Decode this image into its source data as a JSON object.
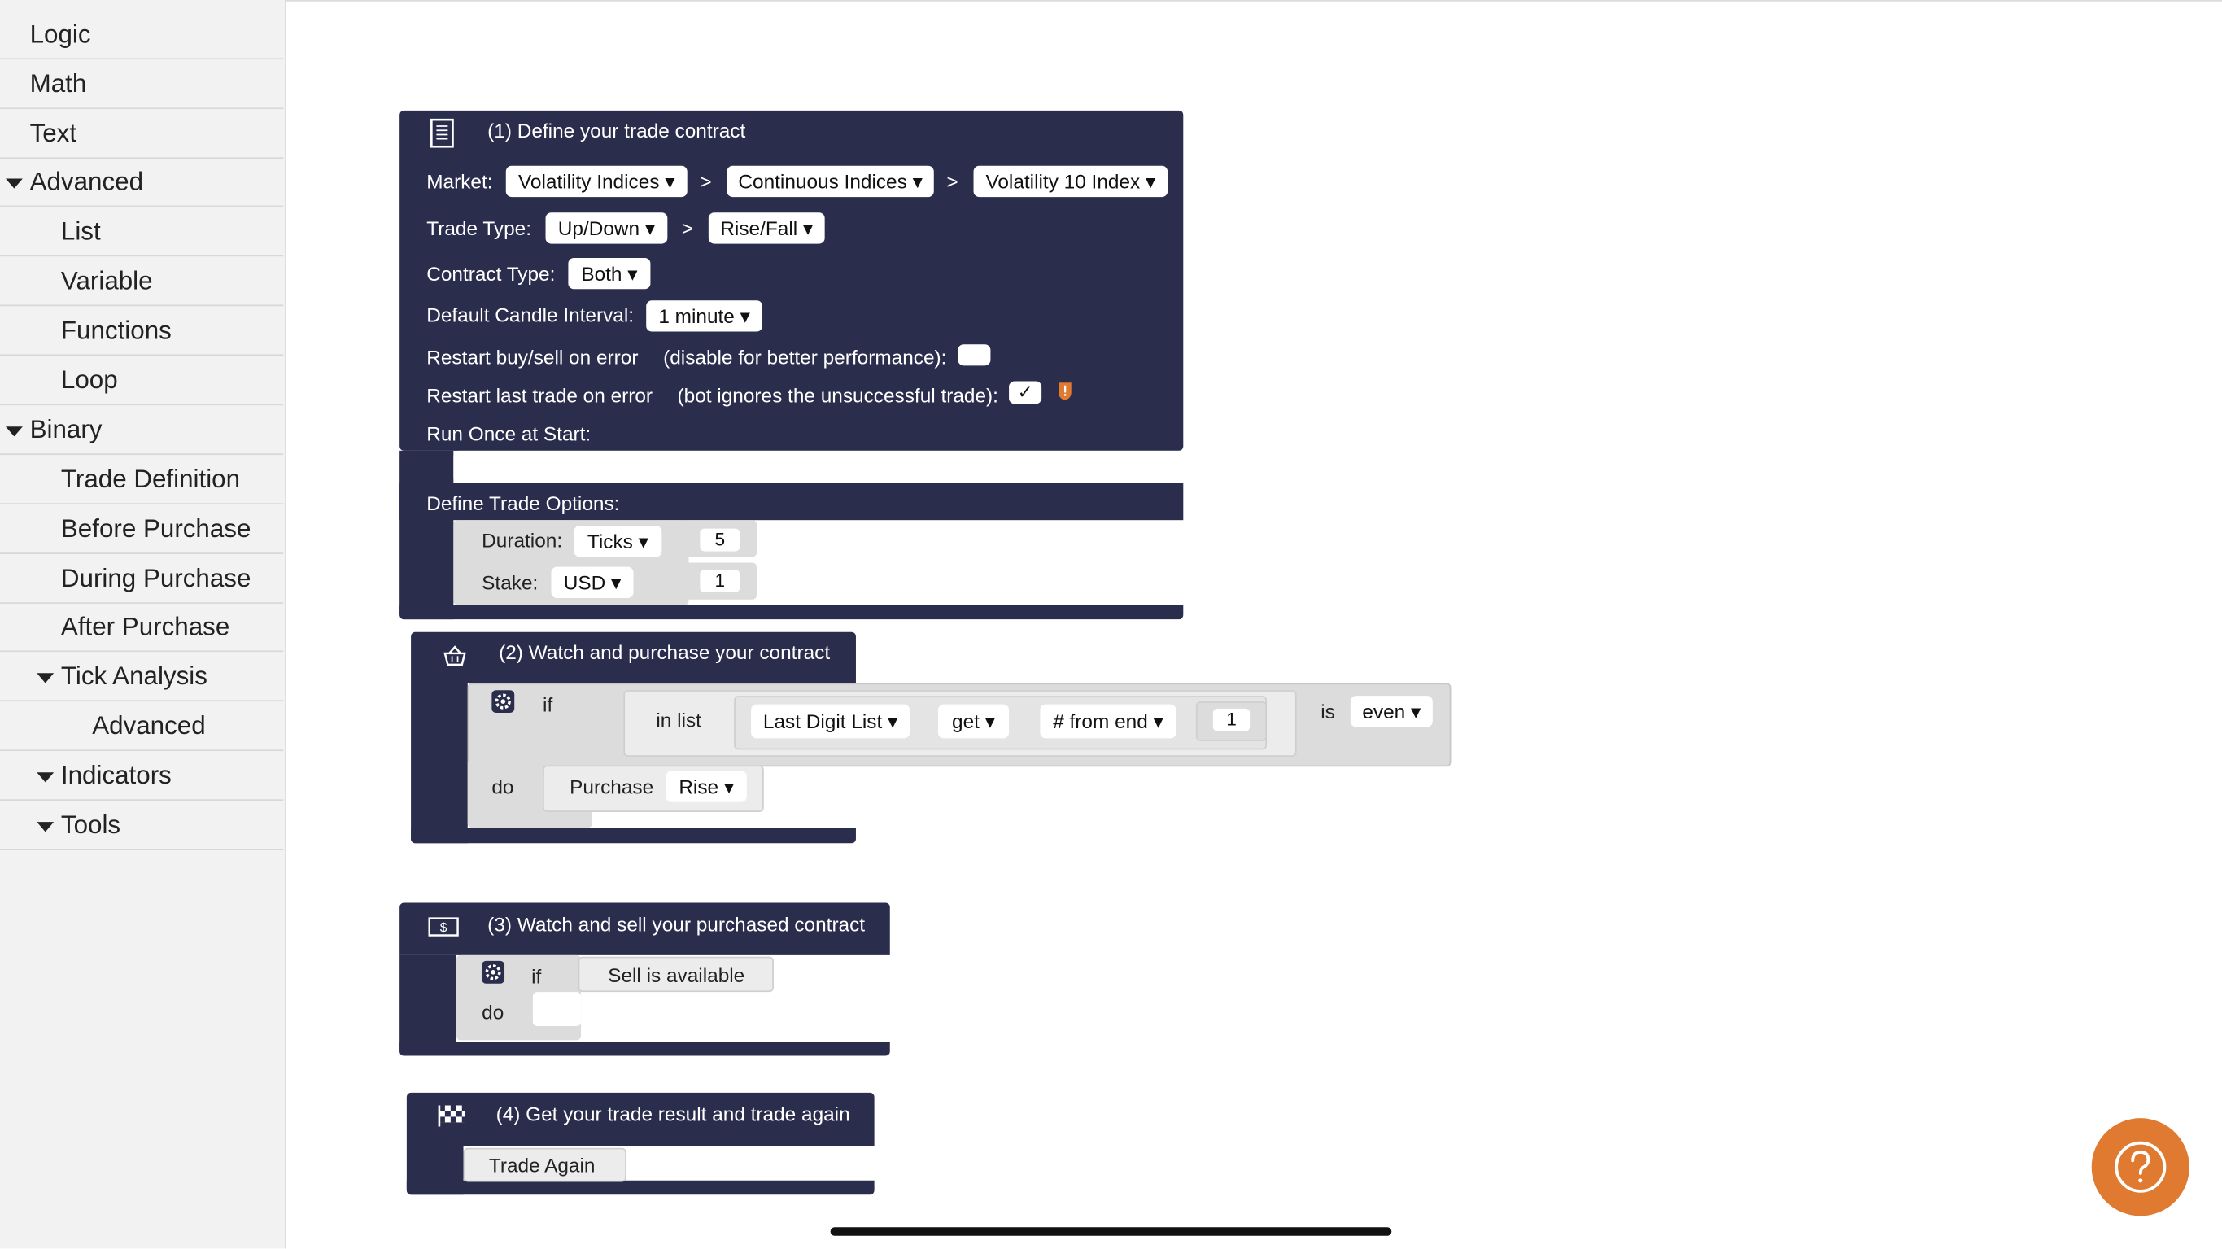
{
  "sidebar": {
    "items": [
      {
        "label": "Logic"
      },
      {
        "label": "Math"
      },
      {
        "label": "Text"
      },
      {
        "label": "Advanced"
      },
      {
        "label": "List"
      },
      {
        "label": "Variable"
      },
      {
        "label": "Functions"
      },
      {
        "label": "Loop"
      },
      {
        "label": "Binary"
      },
      {
        "label": "Trade Definition"
      },
      {
        "label": "Before Purchase"
      },
      {
        "label": "During Purchase"
      },
      {
        "label": "After Purchase"
      },
      {
        "label": "Tick Analysis"
      },
      {
        "label": "Advanced"
      },
      {
        "label": "Indicators"
      },
      {
        "label": "Tools"
      }
    ]
  },
  "trade_definition": {
    "title": "(1) Define your trade contract",
    "market_label": "Market:",
    "market": "Volatility Indices ▾",
    "submarket": "Continuous Indices ▾",
    "symbol": "Volatility 10 Index ▾",
    "sep": ">",
    "trade_type_label": "Trade Type:",
    "trade_type": "Up/Down ▾",
    "trade_subtype": "Rise/Fall ▾",
    "contract_type_label": "Contract Type:",
    "contract_type": "Both ▾",
    "candle_label": "Default Candle Interval:",
    "candle_interval": "1 minute ▾",
    "restart_buysell_label": "Restart buy/sell on error",
    "restart_buysell_hint": "(disable for better performance):",
    "restart_last_label": "Restart last trade on error",
    "restart_last_hint": "(bot ignores the unsuccessful trade):",
    "restart_last_checked": "✓",
    "run_once_label": "Run Once at Start:",
    "define_options_label": "Define Trade Options:",
    "duration_label": "Duration:",
    "duration_unit": "Ticks ▾",
    "duration_value": "5",
    "stake_label": "Stake:",
    "currency": "USD ▾",
    "stake_value": "1"
  },
  "purchase_block": {
    "title": "(2) Watch and purchase your contract",
    "if_label": "if",
    "in_list_label": "in list",
    "list_name": "Last Digit List ▾",
    "get_op": "get ▾",
    "from_end": "# from end ▾",
    "index_value": "1",
    "is_label": "is",
    "parity": "even ▾",
    "do_label": "do",
    "purchase_label": "Purchase",
    "purchase_option": "Rise ▾"
  },
  "sell_block": {
    "title": "(3) Watch and sell your purchased contract",
    "if_label": "if",
    "condition": "Sell is available",
    "do_label": "do"
  },
  "result_block": {
    "title": "(4) Get your trade result and trade again",
    "trade_again": "Trade Again"
  },
  "icons": {
    "block1": "document-icon",
    "block2": "basket-icon",
    "block3": "cash-icon",
    "block4": "checkered-flag-icon",
    "help": "help-icon",
    "warning": "warning-shield-icon",
    "gear": "gear-icon"
  },
  "colors": {
    "block_bg": "#2b2d4d",
    "help_button": "#e07a31",
    "warning": "#e07a31"
  }
}
